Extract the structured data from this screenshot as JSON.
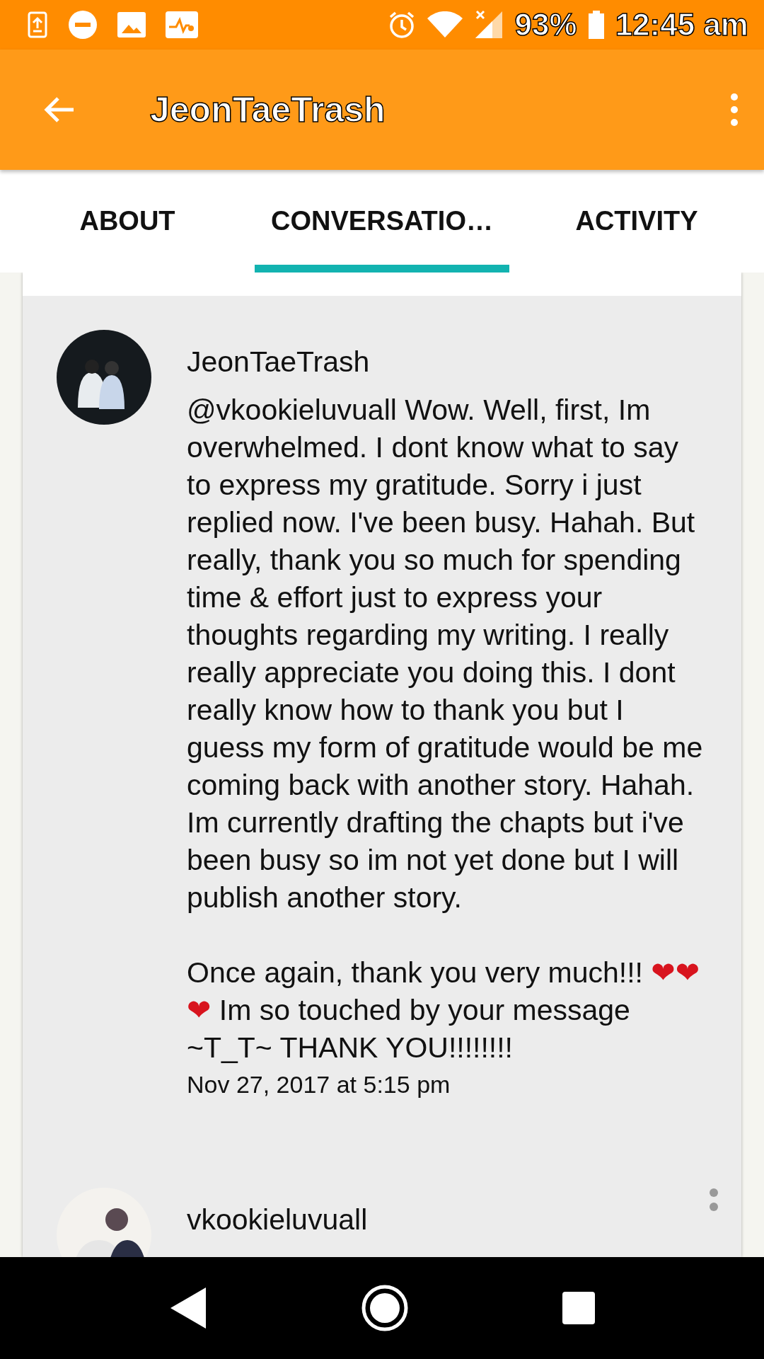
{
  "status_bar": {
    "battery": "93%",
    "time": "12:45 am"
  },
  "app_bar": {
    "title": "JeonTaeTrash"
  },
  "tabs": [
    {
      "label": "ABOUT",
      "selected": false
    },
    {
      "label": "CONVERSATIO…",
      "selected": true
    },
    {
      "label": "ACTIVITY",
      "selected": false
    }
  ],
  "comments": [
    {
      "author": "JeonTaeTrash",
      "paragraphs": [
        [
          {
            "kind": "text",
            "text": "@vkookieluvuall Wow. Well, first, Im overwhelmed. I dont know what to say to express my gratitude. Sorry i just replied now. I've been busy. Hahah. But really, thank you so much for spending time & effort just to express your thoughts regarding my writing. I really really appreciate you doing this. I dont really know how to thank you but I guess my form of gratitude would be me coming back with another story. Hahah. Im currently drafting the chapts but i've been busy so im not yet done but I will publish another story."
          }
        ],
        [
          {
            "kind": "text",
            "text": "Once again, thank you very much!!! "
          },
          {
            "kind": "emoji",
            "text": "❤❤❤"
          },
          {
            "kind": "text",
            "text": " Im so touched by your message ~T_T~ THANK YOU!!!!!!!!"
          }
        ]
      ],
      "time": "Nov 27, 2017 at 5:15 pm"
    },
    {
      "author": "vkookieluvuall"
    }
  ]
}
